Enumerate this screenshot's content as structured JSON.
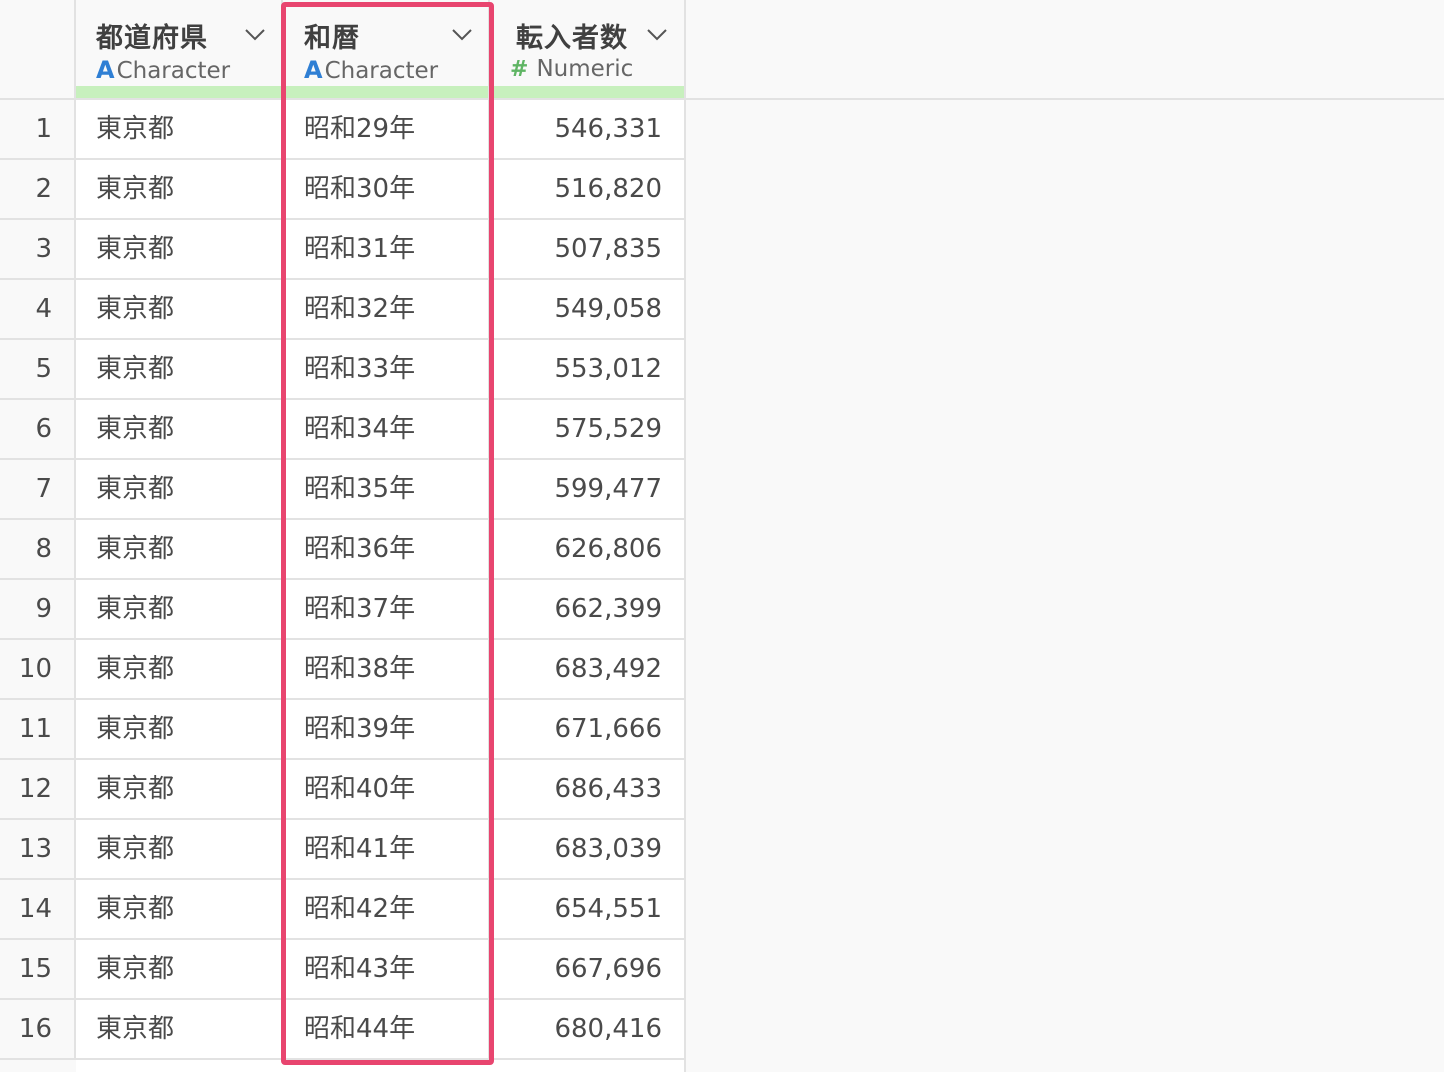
{
  "columns": [
    {
      "name": "都道府県",
      "type_icon": "character-type-icon",
      "type_label": "Character",
      "icon_glyph": "A"
    },
    {
      "name": "和暦",
      "type_icon": "character-type-icon",
      "type_label": "Character",
      "icon_glyph": "A"
    },
    {
      "name": "転入者数",
      "type_icon": "numeric-type-icon",
      "type_label": "Numeric",
      "icon_glyph": "#"
    }
  ],
  "rows": [
    {
      "num": "1",
      "pref": "東京都",
      "era": "昭和29年",
      "count": "546,331"
    },
    {
      "num": "2",
      "pref": "東京都",
      "era": "昭和30年",
      "count": "516,820"
    },
    {
      "num": "3",
      "pref": "東京都",
      "era": "昭和31年",
      "count": "507,835"
    },
    {
      "num": "4",
      "pref": "東京都",
      "era": "昭和32年",
      "count": "549,058"
    },
    {
      "num": "5",
      "pref": "東京都",
      "era": "昭和33年",
      "count": "553,012"
    },
    {
      "num": "6",
      "pref": "東京都",
      "era": "昭和34年",
      "count": "575,529"
    },
    {
      "num": "7",
      "pref": "東京都",
      "era": "昭和35年",
      "count": "599,477"
    },
    {
      "num": "8",
      "pref": "東京都",
      "era": "昭和36年",
      "count": "626,806"
    },
    {
      "num": "9",
      "pref": "東京都",
      "era": "昭和37年",
      "count": "662,399"
    },
    {
      "num": "10",
      "pref": "東京都",
      "era": "昭和38年",
      "count": "683,492"
    },
    {
      "num": "11",
      "pref": "東京都",
      "era": "昭和39年",
      "count": "671,666"
    },
    {
      "num": "12",
      "pref": "東京都",
      "era": "昭和40年",
      "count": "686,433"
    },
    {
      "num": "13",
      "pref": "東京都",
      "era": "昭和41年",
      "count": "683,039"
    },
    {
      "num": "14",
      "pref": "東京都",
      "era": "昭和42年",
      "count": "654,551"
    },
    {
      "num": "15",
      "pref": "東京都",
      "era": "昭和43年",
      "count": "667,696"
    },
    {
      "num": "16",
      "pref": "東京都",
      "era": "昭和44年",
      "count": "680,416"
    }
  ],
  "colors": {
    "highlight": "#e8456f",
    "character_icon": "#2f7fd4",
    "numeric_icon": "#5fb564",
    "header_accent": "#c7f0bd"
  }
}
